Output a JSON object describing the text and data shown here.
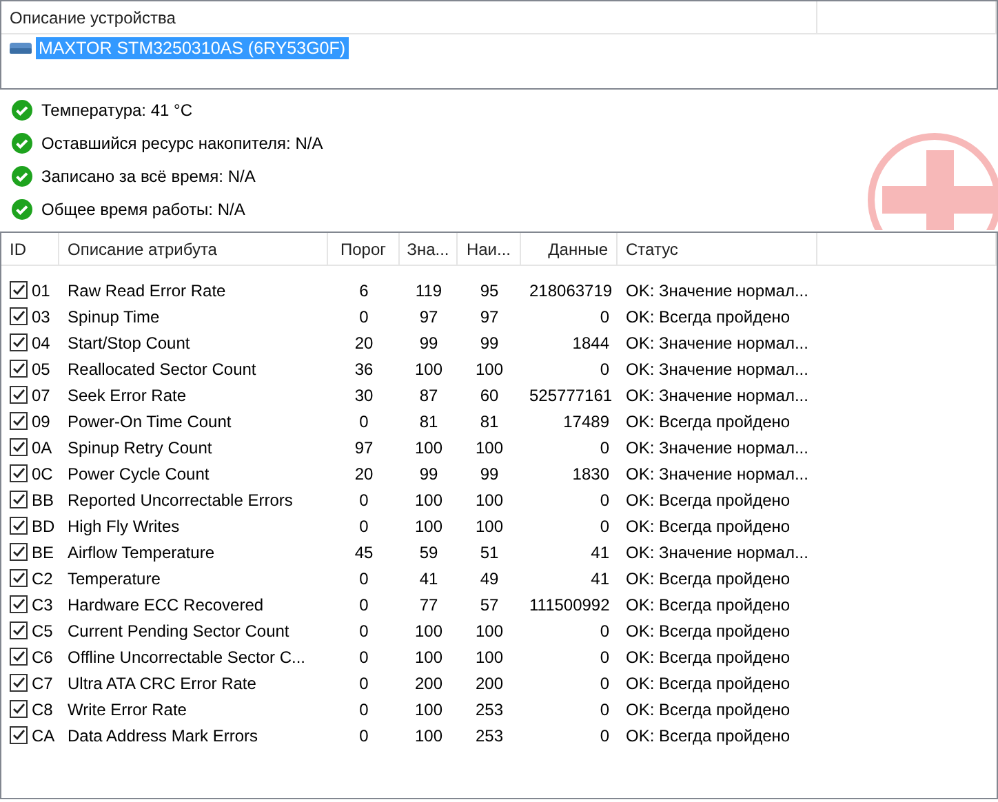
{
  "device_panel": {
    "column_header": "Описание устройства",
    "devices": [
      {
        "name": "MAXTOR STM3250310AS (6RY53G0F)",
        "selected": true
      }
    ]
  },
  "status_lines": [
    {
      "text": "Температура: 41 °C",
      "ok": true
    },
    {
      "text": "Оставшийся ресурс накопителя: N/A",
      "ok": true
    },
    {
      "text": "Записано за всё время: N/A",
      "ok": true
    },
    {
      "text": "Общее время работы: N/A",
      "ok": true
    }
  ],
  "table": {
    "columns": [
      "ID",
      "Описание атрибута",
      "Порог",
      "Зна...",
      "Наи...",
      "Данные",
      "Статус"
    ],
    "rows": [
      {
        "checked": true,
        "id": "01",
        "name": "Raw Read Error Rate",
        "threshold": "6",
        "value": "119",
        "worst": "95",
        "data": "218063719",
        "status": "OK: Значение нормал..."
      },
      {
        "checked": true,
        "id": "03",
        "name": "Spinup Time",
        "threshold": "0",
        "value": "97",
        "worst": "97",
        "data": "0",
        "status": "OK: Всегда пройдено"
      },
      {
        "checked": true,
        "id": "04",
        "name": "Start/Stop Count",
        "threshold": "20",
        "value": "99",
        "worst": "99",
        "data": "1844",
        "status": "OK: Значение нормал..."
      },
      {
        "checked": true,
        "id": "05",
        "name": "Reallocated Sector Count",
        "threshold": "36",
        "value": "100",
        "worst": "100",
        "data": "0",
        "status": "OK: Значение нормал..."
      },
      {
        "checked": true,
        "id": "07",
        "name": "Seek Error Rate",
        "threshold": "30",
        "value": "87",
        "worst": "60",
        "data": "525777161",
        "status": "OK: Значение нормал..."
      },
      {
        "checked": true,
        "id": "09",
        "name": "Power-On Time Count",
        "threshold": "0",
        "value": "81",
        "worst": "81",
        "data": "17489",
        "status": "OK: Всегда пройдено"
      },
      {
        "checked": true,
        "id": "0A",
        "name": "Spinup Retry Count",
        "threshold": "97",
        "value": "100",
        "worst": "100",
        "data": "0",
        "status": "OK: Значение нормал..."
      },
      {
        "checked": true,
        "id": "0C",
        "name": "Power Cycle Count",
        "threshold": "20",
        "value": "99",
        "worst": "99",
        "data": "1830",
        "status": "OK: Значение нормал..."
      },
      {
        "checked": true,
        "id": "BB",
        "name": "Reported Uncorrectable Errors",
        "threshold": "0",
        "value": "100",
        "worst": "100",
        "data": "0",
        "status": "OK: Всегда пройдено"
      },
      {
        "checked": true,
        "id": "BD",
        "name": "High Fly Writes",
        "threshold": "0",
        "value": "100",
        "worst": "100",
        "data": "0",
        "status": "OK: Всегда пройдено"
      },
      {
        "checked": true,
        "id": "BE",
        "name": "Airflow Temperature",
        "threshold": "45",
        "value": "59",
        "worst": "51",
        "data": "41",
        "status": "OK: Значение нормал..."
      },
      {
        "checked": true,
        "id": "C2",
        "name": "Temperature",
        "threshold": "0",
        "value": "41",
        "worst": "49",
        "data": "41",
        "status": "OK: Всегда пройдено"
      },
      {
        "checked": true,
        "id": "C3",
        "name": "Hardware ECC Recovered",
        "threshold": "0",
        "value": "77",
        "worst": "57",
        "data": "111500992",
        "status": "OK: Всегда пройдено"
      },
      {
        "checked": true,
        "id": "C5",
        "name": "Current Pending Sector Count",
        "threshold": "0",
        "value": "100",
        "worst": "100",
        "data": "0",
        "status": "OK: Всегда пройдено"
      },
      {
        "checked": true,
        "id": "C6",
        "name": "Offline Uncorrectable Sector C...",
        "threshold": "0",
        "value": "100",
        "worst": "100",
        "data": "0",
        "status": "OK: Всегда пройдено"
      },
      {
        "checked": true,
        "id": "C7",
        "name": "Ultra ATA CRC Error Rate",
        "threshold": "0",
        "value": "200",
        "worst": "200",
        "data": "0",
        "status": "OK: Всегда пройдено"
      },
      {
        "checked": true,
        "id": "C8",
        "name": "Write Error Rate",
        "threshold": "0",
        "value": "100",
        "worst": "253",
        "data": "0",
        "status": "OK: Всегда пройдено"
      },
      {
        "checked": true,
        "id": "CA",
        "name": "Data Address Mark Errors",
        "threshold": "0",
        "value": "100",
        "worst": "253",
        "data": "0",
        "status": "OK: Всегда пройдено"
      }
    ]
  }
}
